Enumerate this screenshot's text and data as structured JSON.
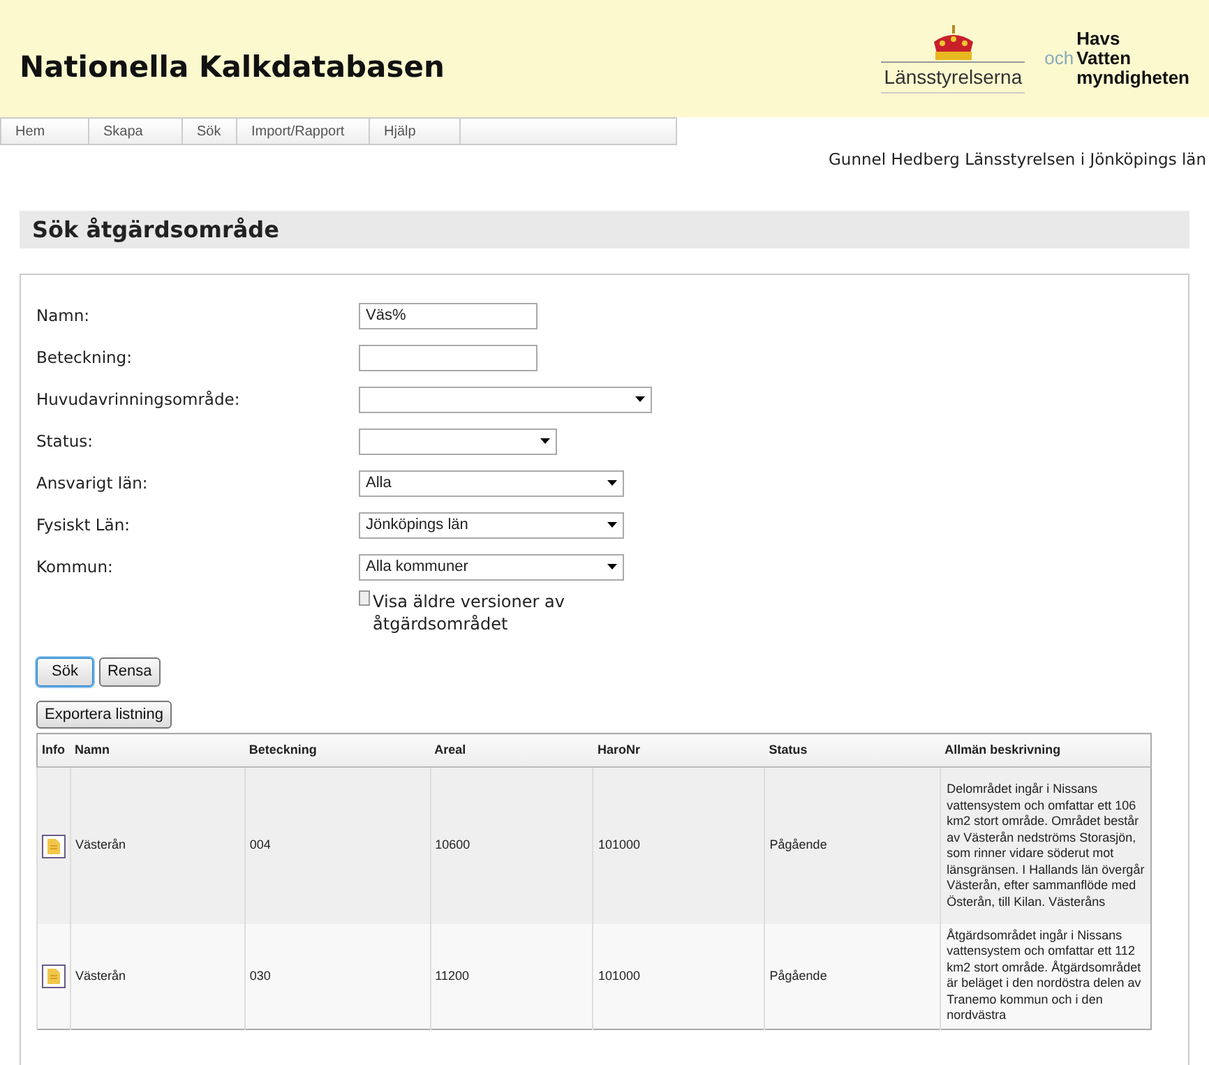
{
  "header": {
    "title": "Nationella Kalkdatabasen",
    "logo_1": "Länsstyrelserna",
    "logo_2": {
      "prefix": "och",
      "lines": [
        "Havs",
        "Vatten",
        "myndigheten"
      ]
    }
  },
  "menu": [
    {
      "label": "Hem"
    },
    {
      "label": "Skapa"
    },
    {
      "label": "Sök"
    },
    {
      "label": "Import/Rapport"
    },
    {
      "label": "Hjälp"
    }
  ],
  "user": "Gunnel Hedberg Länsstyrelsen i Jönköpings län",
  "page_title": "Sök åtgärdsområde",
  "form": {
    "fields": [
      {
        "label": "Namn:",
        "kind": "text",
        "value": "Väs%"
      },
      {
        "label": "Beteckning:",
        "kind": "text"
      },
      {
        "label": "Huvudavrinningsområde:",
        "kind": "select"
      },
      {
        "label": "Status:",
        "kind": "select"
      },
      {
        "label": "Ansvarigt län:",
        "kind": "select",
        "value": "Alla"
      },
      {
        "label": "Fysiskt Län:",
        "kind": "select",
        "value": "Jönköpings län"
      },
      {
        "label": "Kommun:",
        "kind": "select",
        "value": "Alla kommuner"
      }
    ],
    "checkbox": {
      "label": "Visa äldre versioner av åtgärdsområdet",
      "checked": false
    },
    "buttons": [
      {
        "label": "Sök",
        "focused": true
      },
      {
        "label": "Rensa",
        "focused": false
      }
    ],
    "export_button": "Exportera listning"
  },
  "table": {
    "columns": [
      "Info",
      "Namn",
      "Beteckning",
      "Areal",
      "HaroNr",
      "Status",
      "Allmän beskrivning"
    ],
    "rows": [
      {
        "cells": [
          null,
          "Västerån",
          "004",
          "10600",
          "101000",
          "Pågående",
          "Delområdet ingår i Nissans vattensystem och omfattar ett 106 km2 stort område. Området består av Västerån nedströms Storasjön, som rinner vidare söderut mot länsgränsen. I Hallands län övergår Västerån, efter sammanflöde med Österån, till Kilan. Västeråns"
        ]
      },
      {
        "cells": [
          null,
          "Västerån",
          "030",
          "11200",
          "101000",
          "Pågående",
          "Åtgärdsområdet ingår i Nissans vattensystem och omfattar ett 112 km2 stort område. Åtgärdsområdet är beläget i den nordöstra delen av Tranemo kommun och i den nordvästra"
        ]
      }
    ]
  }
}
